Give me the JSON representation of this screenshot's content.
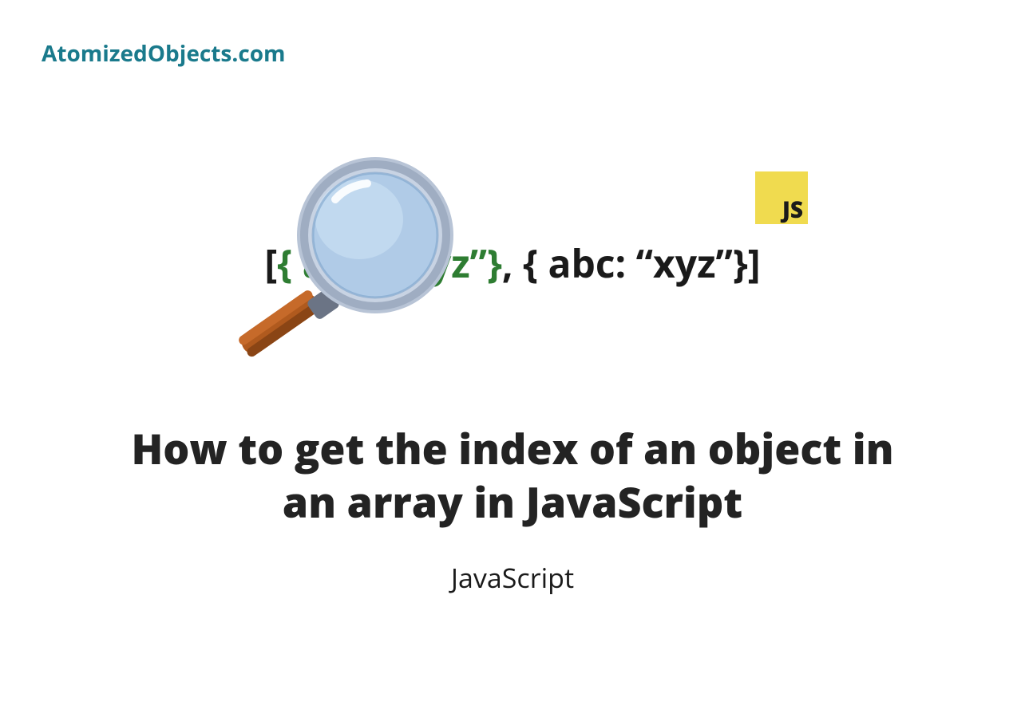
{
  "site": {
    "name": "AtomizedObjects.com"
  },
  "hero": {
    "code": {
      "bracket_open": "[",
      "obj1": "{ abc: “xyz”}",
      "comma": ", ",
      "obj2": "{ abc: “xyz”}",
      "bracket_close": "]"
    },
    "js_badge": "JS"
  },
  "article": {
    "title": "How to get the index of an object in an array in JavaScript",
    "category": "JavaScript"
  },
  "colors": {
    "brand": "#1a7a8c",
    "highlight": "#2e7d32",
    "js_badge_bg": "#f0db4f",
    "text_dark": "#232323"
  }
}
